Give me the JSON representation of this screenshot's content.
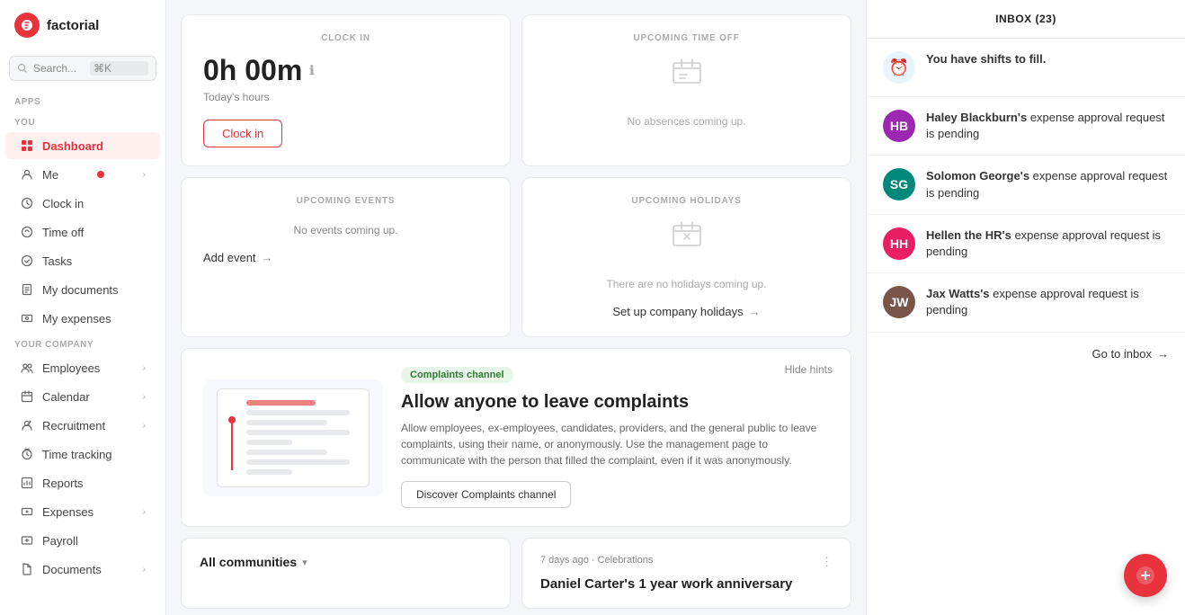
{
  "logo": {
    "text": "factorial",
    "icon": "f"
  },
  "search": {
    "placeholder": "Search...",
    "kbd": "⌘K"
  },
  "sidebar": {
    "apps_label": "Apps",
    "you_label": "YOU",
    "your_company_label": "YOUR COMPANY",
    "items_you": [
      {
        "id": "dashboard",
        "label": "Dashboard",
        "icon": "⬤",
        "active": true
      },
      {
        "id": "me",
        "label": "Me",
        "icon": "👤",
        "has_dot": true,
        "has_chevron": true
      },
      {
        "id": "clock-in",
        "label": "Clock in",
        "icon": "⏰"
      },
      {
        "id": "time-off",
        "label": "Time off",
        "icon": "🏖"
      },
      {
        "id": "tasks",
        "label": "Tasks",
        "icon": "✓"
      },
      {
        "id": "my-documents",
        "label": "My documents",
        "icon": "📄"
      },
      {
        "id": "my-expenses",
        "label": "My expenses",
        "icon": "💳"
      }
    ],
    "items_company": [
      {
        "id": "employees",
        "label": "Employees",
        "icon": "👥",
        "has_chevron": true
      },
      {
        "id": "calendar",
        "label": "Calendar",
        "icon": "📅",
        "has_chevron": true
      },
      {
        "id": "recruitment",
        "label": "Recruitment",
        "icon": "🎯",
        "has_chevron": true
      },
      {
        "id": "time-tracking",
        "label": "Time tracking",
        "icon": "⏱"
      },
      {
        "id": "reports",
        "label": "Reports",
        "icon": "📊"
      },
      {
        "id": "expenses",
        "label": "Expenses",
        "icon": "💰",
        "has_chevron": true
      },
      {
        "id": "payroll",
        "label": "Payroll",
        "icon": "💵"
      },
      {
        "id": "documents",
        "label": "Documents",
        "icon": "📁",
        "has_chevron": true
      }
    ]
  },
  "clock_card": {
    "title": "CLOCK IN",
    "time": "0h 00m",
    "subtitle": "Today's hours",
    "button_label": "Clock in"
  },
  "time_off_card": {
    "title": "UPCOMING TIME OFF",
    "empty_text": "No absences coming up."
  },
  "events_card": {
    "title": "UPCOMING EVENTS",
    "empty_text": "No events coming up.",
    "link_label": "Add event"
  },
  "holidays_card": {
    "title": "UPCOMING HOLIDAYS",
    "empty_text": "There are no holidays coming up.",
    "link_label": "Set up company holidays"
  },
  "hints_card": {
    "badge": "Complaints channel",
    "title": "Allow anyone to leave complaints",
    "description": "Allow employees, ex-employees, candidates, providers, and the general public to leave complaints, using their name, or anonymously. Use the management page to communicate with the person that filled the complaint, even if it was anonymously.",
    "button_label": "Discover Complaints channel",
    "hide_label": "Hide hints"
  },
  "communities_card": {
    "title": "All communities",
    "chevron": "▼"
  },
  "celebrations_card": {
    "meta": "7 days ago · Celebrations",
    "title": "Daniel Carter's 1 year work anniversary"
  },
  "inbox": {
    "title": "INBOX (23)",
    "items": [
      {
        "id": "shifts",
        "type": "clock",
        "text": "You have shifts to fill.",
        "bold_part": "You have shifts to fill."
      },
      {
        "id": "haley",
        "type": "avatar",
        "color": "purple",
        "initials": "HB",
        "text": "Haley Blackburn's expense approval request is pending"
      },
      {
        "id": "solomon",
        "type": "avatar",
        "color": "teal",
        "initials": "SG",
        "text": "Solomon George's expense approval request is pending"
      },
      {
        "id": "hellen",
        "type": "avatar",
        "color": "pink",
        "initials": "HH",
        "text": "Hellen the HR's expense approval request is pending"
      },
      {
        "id": "jax",
        "type": "avatar",
        "color": "brown",
        "initials": "JW",
        "text": "Jax Watts's expense approval request is pending"
      }
    ],
    "go_inbox_label": "Go to inbox"
  }
}
